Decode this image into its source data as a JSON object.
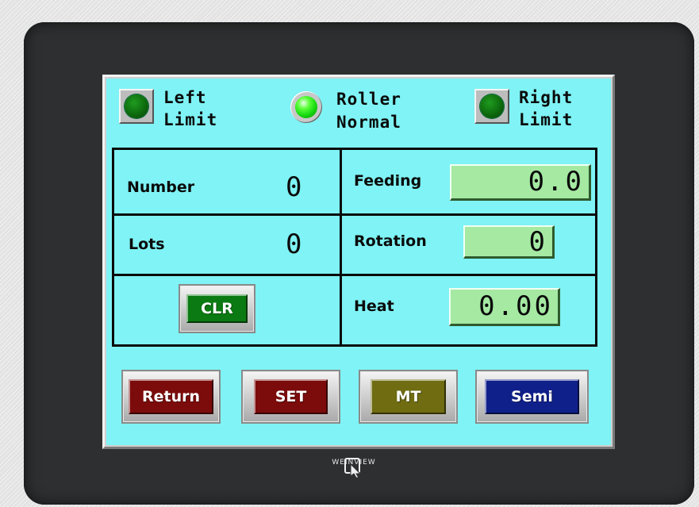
{
  "indicators": {
    "left_limit": {
      "line1": "Left",
      "line2": "Limit",
      "state": "off"
    },
    "roller": {
      "line1": "Roller",
      "line2": "Normal",
      "state": "on"
    },
    "right_limit": {
      "line1": "Right",
      "line2": "Limit",
      "state": "off"
    }
  },
  "counters": {
    "number": {
      "label": "Number",
      "value": "0"
    },
    "lots": {
      "label": "Lots",
      "value": "0"
    }
  },
  "parameters": {
    "feeding": {
      "label": "Feeding",
      "value": "0.0"
    },
    "rotation": {
      "label": "Rotation",
      "value": "0"
    },
    "heat": {
      "label": "Heat",
      "value": "0.00"
    }
  },
  "clear_button": {
    "label": "CLR",
    "color": "#0c7a12"
  },
  "nav_buttons": [
    {
      "label": "Return",
      "color": "#7c0b0b"
    },
    {
      "label": "SET",
      "color": "#7c0b0b"
    },
    {
      "label": "MT",
      "color": "#6f6c12"
    },
    {
      "label": "Semi",
      "color": "#10208a"
    }
  ],
  "colors": {
    "screen_bg": "#7ff3f5",
    "value_box": "#a5e9a3",
    "bezel": "#2d2f30",
    "led_on": "#2cff1f",
    "led_off": "#0d6b0d"
  },
  "branding": {
    "label": "WEINVIEW",
    "icon": "weinview-logo-icon"
  }
}
